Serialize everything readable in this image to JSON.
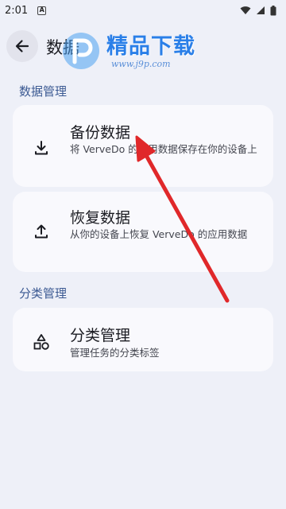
{
  "status_bar": {
    "time": "2:01",
    "indicator": "A"
  },
  "app_bar": {
    "title": "数据",
    "back_icon": "arrow-left-icon"
  },
  "watermark": {
    "brand": "精品下载",
    "url": "www.j9p.com"
  },
  "sections": [
    {
      "label": "数据管理",
      "cards": [
        {
          "icon": "download-icon",
          "title": "备份数据",
          "description": "将 VerveDo 的应用数据保存在你的设备上"
        },
        {
          "icon": "upload-icon",
          "title": "恢复数据",
          "description": "从你的设备上恢复 VerveDo 的应用数据"
        }
      ]
    },
    {
      "label": "分类管理",
      "cards": [
        {
          "icon": "shapes-icon",
          "title": "分类管理",
          "description": "管理任务的分类标签"
        }
      ]
    }
  ],
  "colors": {
    "background": "#eef0f8",
    "card": "#f9f9fd",
    "section_label": "#3c5a93",
    "annotation_arrow": "#e0282a"
  }
}
